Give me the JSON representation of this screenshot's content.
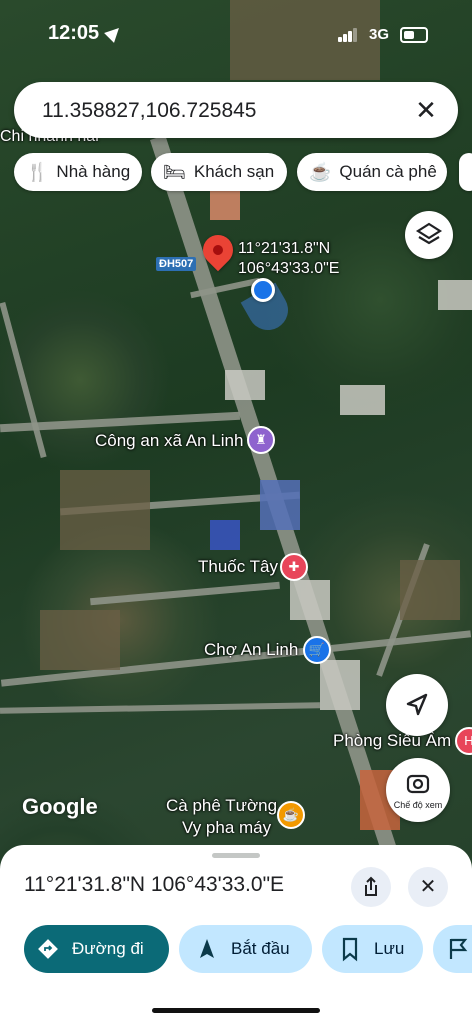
{
  "status_bar": {
    "time": "12:05",
    "network": "3G"
  },
  "search": {
    "value": "11.358827,106.725845",
    "clear_icon": "close-icon"
  },
  "chips": [
    {
      "label": "Nhà hàng",
      "icon": "restaurant-icon"
    },
    {
      "label": "Khách sạn",
      "icon": "hotel-icon"
    },
    {
      "label": "Quán cà phê",
      "icon": "cafe-icon"
    }
  ],
  "map": {
    "pin_coords_line1": "11°21'31.8\"N",
    "pin_coords_line2": "106°43'33.0\"E",
    "road_shield": "ĐH507",
    "top_label": "Chi nhánh hai",
    "places": {
      "police": "Công an xã An Linh",
      "pharmacy": "Thuốc Tây",
      "market": "Chợ An Linh",
      "clinic": "Phòng Siêu Âm",
      "cafe_line1": "Cà phê Tường",
      "cafe_line2": "Vy pha máy"
    },
    "street_view_label": "Chế độ xem",
    "attribution": "Google"
  },
  "sheet": {
    "coords": "11°21'31.8\"N 106°43'33.0\"E",
    "buttons": {
      "directions": "Đường đi",
      "start": "Bắt đầu",
      "save": "Lưu"
    }
  },
  "colors": {
    "accent": "#0b57d0",
    "primary_button": "#0b6a77",
    "pin": "#ea4335"
  }
}
